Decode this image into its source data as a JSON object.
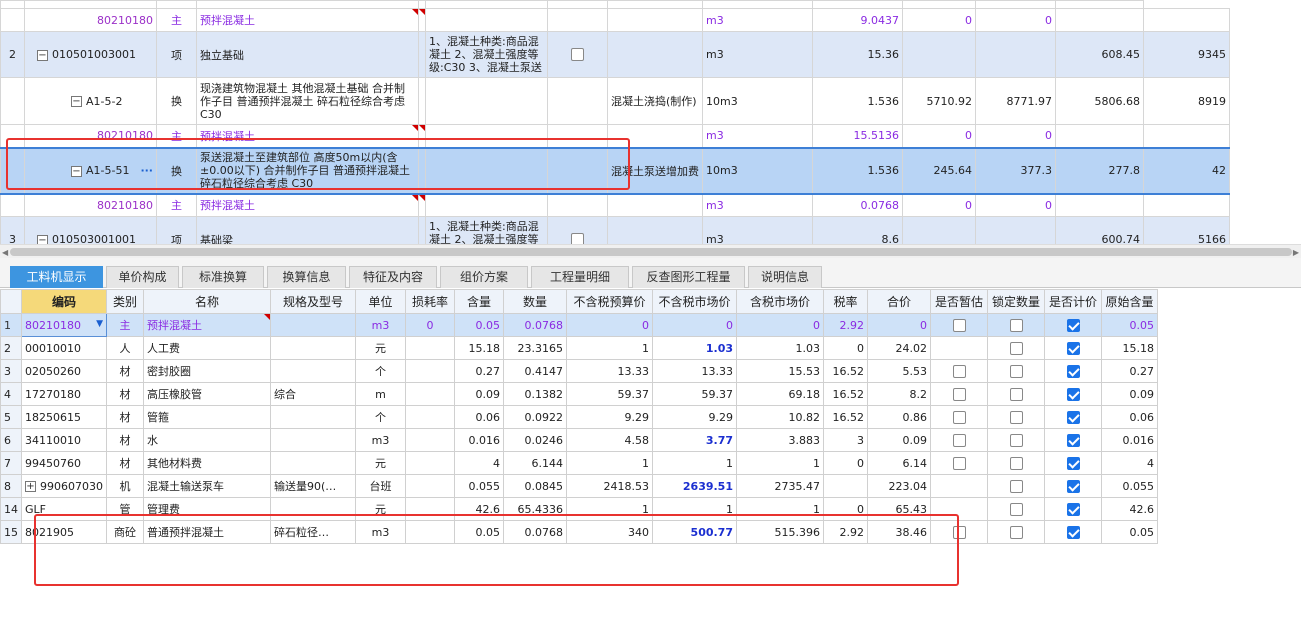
{
  "upper_rows": [
    {
      "kind": "sub",
      "no": "",
      "code": "80210180",
      "type": "主",
      "name": "预拌混凝土",
      "feature": "",
      "rule": "",
      "unit": "m3",
      "qty": "9.0437",
      "p1": "0",
      "p2": "0",
      "p3": "",
      "p4": ""
    },
    {
      "kind": "item",
      "no": "2",
      "code": "010501003001",
      "type": "项",
      "name": "独立基础",
      "feature": "1、混凝土种类:商品混凝土\n2、混凝土强度等级:C30\n3、混凝土泵送",
      "rule": "",
      "unit": "m3",
      "qty": "15.36",
      "p1": "",
      "p2": "",
      "p3": "608.45",
      "p4": "9345"
    },
    {
      "kind": "conv",
      "no": "",
      "code": "A1-5-2",
      "type": "换",
      "name": "现浇建筑物混凝土 其他混凝土基础 合并制作子目 普通预拌混凝土 碎石粒径综合考虑 C30",
      "feature": "",
      "rule": "混凝土浇捣(制作)",
      "unit": "10m3",
      "qty": "1.536",
      "p1": "5710.92",
      "p2": "8771.97",
      "p3": "5806.68",
      "p4": "8919"
    },
    {
      "kind": "sub",
      "no": "",
      "code": "80210180",
      "type": "主",
      "name": "预拌混凝土",
      "feature": "",
      "rule": "",
      "unit": "m3",
      "qty": "15.5136",
      "p1": "0",
      "p2": "0",
      "p3": "",
      "p4": ""
    },
    {
      "kind": "sel",
      "no": "",
      "code": "A1-5-51",
      "type": "换",
      "name": "泵送混凝土至建筑部位 高度50m以内(含±0.00以下) 合并制作子目 普通预拌混凝土 碎石粒径综合考虑 C30",
      "feature": "",
      "rule": "混凝土泵送增加费",
      "unit": "10m3",
      "qty": "1.536",
      "p1": "245.64",
      "p2": "377.3",
      "p3": "277.8",
      "p4": "42"
    },
    {
      "kind": "sub",
      "no": "",
      "code": "80210180",
      "type": "主",
      "name": "预拌混凝土",
      "feature": "",
      "rule": "",
      "unit": "m3",
      "qty": "0.0768",
      "p1": "0",
      "p2": "0",
      "p3": "",
      "p4": ""
    },
    {
      "kind": "item",
      "no": "3",
      "code": "010503001001",
      "type": "项",
      "name": "基础梁",
      "feature": "1、混凝土种类:商品混凝土\n2、混凝土强度等级:C30",
      "rule": "",
      "unit": "m3",
      "qty": "8.6",
      "p1": "",
      "p2": "",
      "p3": "600.74",
      "p4": "5166"
    }
  ],
  "tabs": [
    "工料机显示",
    "单价构成",
    "标准换算",
    "换算信息",
    "特征及内容",
    "组价方案",
    "工程量明细",
    "反查图形工程量",
    "说明信息"
  ],
  "columns": [
    "",
    "编码",
    "类别",
    "名称",
    "规格及型号",
    "单位",
    "损耗率",
    "含量",
    "数量",
    "不含税预算价",
    "不含税市场价",
    "含税市场价",
    "税率",
    "合价",
    "是否暂估",
    "锁定数量",
    "是否计价",
    "原始含量"
  ],
  "rows": [
    {
      "n": "1",
      "code": "80210180",
      "cat": "主",
      "name": "预拌混凝土",
      "spec": "",
      "unit": "m3",
      "loss": "0",
      "content": "0.05",
      "qty": "0.0768",
      "budget": "0",
      "market": "0",
      "market_tax": "0",
      "tax": "2.92",
      "total": "0",
      "est": false,
      "lock": false,
      "priced": true,
      "orig": "0.05",
      "sel": true,
      "blue": false
    },
    {
      "n": "2",
      "code": "00010010",
      "cat": "人",
      "name": "人工费",
      "spec": "",
      "unit": "元",
      "loss": "",
      "content": "15.18",
      "qty": "23.3165",
      "budget": "1",
      "market": "1.03",
      "market_tax": "1.03",
      "tax": "0",
      "total": "24.02",
      "est": null,
      "lock": false,
      "priced": true,
      "orig": "15.18",
      "blue": true
    },
    {
      "n": "3",
      "code": "02050260",
      "cat": "材",
      "name": "密封胶圈",
      "spec": "",
      "unit": "个",
      "loss": "",
      "content": "0.27",
      "qty": "0.4147",
      "budget": "13.33",
      "market": "13.33",
      "market_tax": "15.53",
      "tax": "16.52",
      "total": "5.53",
      "est": false,
      "lock": false,
      "priced": true,
      "orig": "0.27",
      "blue": false
    },
    {
      "n": "4",
      "code": "17270180",
      "cat": "材",
      "name": "高压橡胶管",
      "spec": "综合",
      "unit": "m",
      "loss": "",
      "content": "0.09",
      "qty": "0.1382",
      "budget": "59.37",
      "market": "59.37",
      "market_tax": "69.18",
      "tax": "16.52",
      "total": "8.2",
      "est": false,
      "lock": false,
      "priced": true,
      "orig": "0.09",
      "blue": false
    },
    {
      "n": "5",
      "code": "18250615",
      "cat": "材",
      "name": "管箍",
      "spec": "",
      "unit": "个",
      "loss": "",
      "content": "0.06",
      "qty": "0.0922",
      "budget": "9.29",
      "market": "9.29",
      "market_tax": "10.82",
      "tax": "16.52",
      "total": "0.86",
      "est": false,
      "lock": false,
      "priced": true,
      "orig": "0.06",
      "blue": false
    },
    {
      "n": "6",
      "code": "34110010",
      "cat": "材",
      "name": "水",
      "spec": "",
      "unit": "m3",
      "loss": "",
      "content": "0.016",
      "qty": "0.0246",
      "budget": "4.58",
      "market": "3.77",
      "market_tax": "3.883",
      "tax": "3",
      "total": "0.09",
      "est": false,
      "lock": false,
      "priced": true,
      "orig": "0.016",
      "blue": true
    },
    {
      "n": "7",
      "code": "99450760",
      "cat": "材",
      "name": "其他材料费",
      "spec": "",
      "unit": "元",
      "loss": "",
      "content": "4",
      "qty": "6.144",
      "budget": "1",
      "market": "1",
      "market_tax": "1",
      "tax": "0",
      "total": "6.14",
      "est": false,
      "lock": false,
      "priced": true,
      "orig": "4",
      "blue": false
    },
    {
      "n": "8",
      "code": "990607030",
      "cat": "机",
      "name": "混凝土输送泵车",
      "spec": "输送量90(…",
      "unit": "台班",
      "loss": "",
      "content": "0.055",
      "qty": "0.0845",
      "budget": "2418.53",
      "market": "2639.51",
      "market_tax": "2735.47",
      "tax": "",
      "total": "223.04",
      "est": null,
      "lock": false,
      "priced": true,
      "orig": "0.055",
      "blue": true,
      "plus": true
    },
    {
      "n": "14",
      "code": "GLF",
      "cat": "管",
      "name": "管理费",
      "spec": "",
      "unit": "元",
      "loss": "",
      "content": "42.6",
      "qty": "65.4336",
      "budget": "1",
      "market": "1",
      "market_tax": "1",
      "tax": "0",
      "total": "65.43",
      "est": null,
      "lock": false,
      "priced": true,
      "orig": "42.6",
      "blue": false
    },
    {
      "n": "15",
      "code": "8021905",
      "cat": "商砼",
      "name": "普通预拌混凝土",
      "spec": "碎石粒径…",
      "unit": "m3",
      "loss": "",
      "content": "0.05",
      "qty": "0.0768",
      "budget": "340",
      "market": "500.77",
      "market_tax": "515.396",
      "tax": "2.92",
      "total": "38.46",
      "est": false,
      "lock": false,
      "priced": true,
      "orig": "0.05",
      "blue": true
    }
  ],
  "colors": {
    "accent": "#3d95e0",
    "annotation": "#e8322f",
    "selected_row": "#b8d4f5"
  }
}
